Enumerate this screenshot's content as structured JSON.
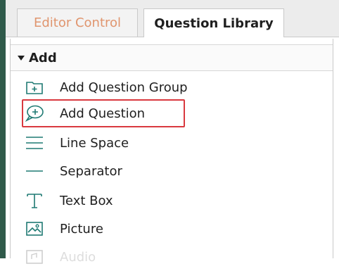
{
  "tabs": [
    {
      "label": "Editor Control"
    },
    {
      "label": "Question Library"
    }
  ],
  "section": {
    "title": "Add"
  },
  "items": [
    {
      "label": "Add Question Group",
      "icon": "folder-plus-icon"
    },
    {
      "label": "Add Question",
      "icon": "speech-bubble-plus-icon"
    },
    {
      "label": "Line Space",
      "icon": "line-space-icon"
    },
    {
      "label": "Separator",
      "icon": "separator-icon"
    },
    {
      "label": "Text Box",
      "icon": "text-box-icon"
    },
    {
      "label": "Picture",
      "icon": "picture-icon"
    },
    {
      "label": "Audio",
      "icon": "audio-icon"
    }
  ],
  "colors": {
    "accent_teal": "#1f7a73",
    "highlight_red": "#d9393f",
    "tab_inactive_text": "#e0956e"
  }
}
